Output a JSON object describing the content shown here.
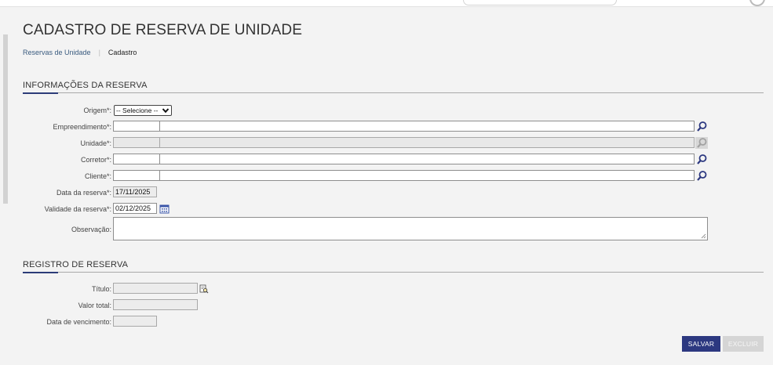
{
  "page": {
    "title": "CADASTRO DE RESERVA DE UNIDADE",
    "breadcrumb": {
      "link": "Reservas de Unidade",
      "current": "Cadastro"
    }
  },
  "section_reserva": {
    "title": "INFORMAÇÕES DA RESERVA",
    "origem": {
      "label": "Origem*:",
      "selected": "-- Selecione --"
    },
    "empreendimento": {
      "label": "Empreendimento*:",
      "code": "",
      "name": ""
    },
    "unidade": {
      "label": "Unidade*:",
      "code": "",
      "name": ""
    },
    "corretor": {
      "label": "Corretor*:",
      "code": "",
      "name": ""
    },
    "cliente": {
      "label": "Cliente*:",
      "code": "",
      "name": ""
    },
    "data_reserva": {
      "label": "Data da reserva*:",
      "value": "17/11/2025"
    },
    "validade_reserva": {
      "label": "Validade da reserva*:",
      "value": "02/12/2025"
    },
    "observacao": {
      "label": "Observação:",
      "value": ""
    }
  },
  "section_registro": {
    "title": "REGISTRO DE RESERVA",
    "titulo": {
      "label": "Título:",
      "value": ""
    },
    "valor_total": {
      "label": "Valor total:",
      "value": ""
    },
    "data_vencimento": {
      "label": "Data de vencimento:",
      "value": ""
    }
  },
  "actions": {
    "save": "SALVAR",
    "delete": "EXCLUIR"
  },
  "icons": {
    "lookup": "search-icon",
    "calendar": "calendar-icon",
    "document": "document-search-icon",
    "dropdown": "chevron-down-icon"
  },
  "colors": {
    "accent": "#2c3880",
    "link": "#3a5b7f",
    "disabled_button": "#d5d5d5",
    "background": "#f3f3f3"
  }
}
